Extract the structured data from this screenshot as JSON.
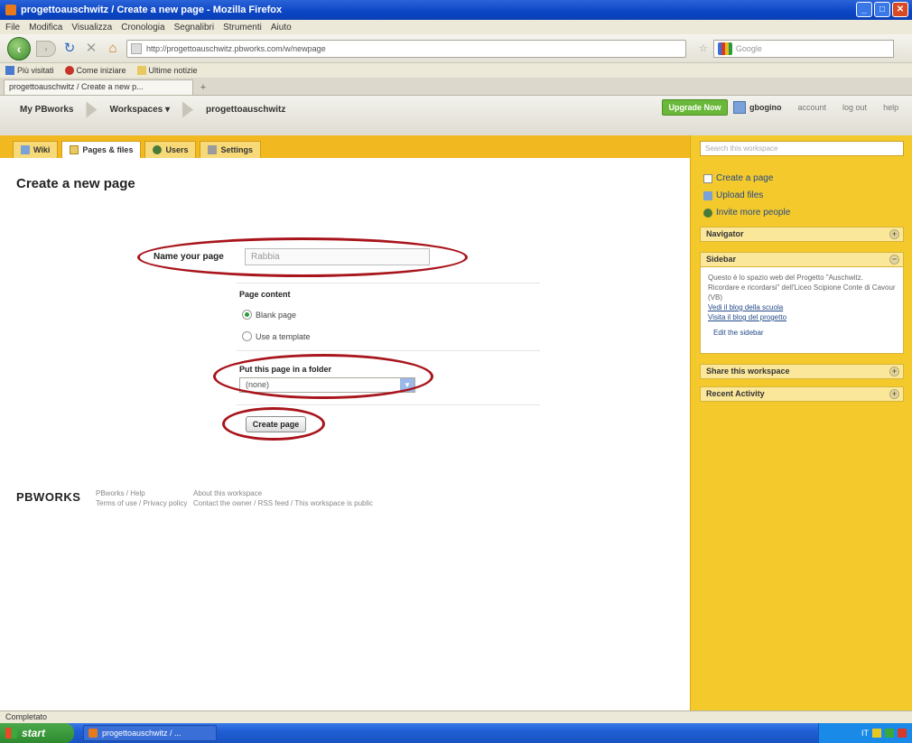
{
  "window": {
    "title": "progettoauschwitz / Create a new page - Mozilla Firefox"
  },
  "menu": [
    "File",
    "Modifica",
    "Visualizza",
    "Cronologia",
    "Segnalibri",
    "Strumenti",
    "Aiuto"
  ],
  "nav": {
    "url": "http://progettoauschwitz.pbworks.com/w/newpage",
    "search_placeholder": "Google"
  },
  "bookmarks": [
    {
      "label": "Più visitati",
      "icon": "blue"
    },
    {
      "label": "Come iniziare",
      "icon": "red"
    },
    {
      "label": "Ultime notizie",
      "icon": "folder"
    }
  ],
  "tab": {
    "label": "progettoauschwitz / Create a new p..."
  },
  "header": {
    "crumbs": [
      "My PBworks",
      "Workspaces",
      "progettoauschwitz"
    ],
    "workspaces_arrow": "▾",
    "upgrade_label": "Upgrade Now",
    "user_name": "gbogino",
    "links": [
      "account",
      "log out",
      "help"
    ]
  },
  "page_tabs": [
    {
      "label": "Wiki",
      "icon": "wiki",
      "active": false
    },
    {
      "label": "Pages & files",
      "icon": "pages",
      "active": true
    },
    {
      "label": "Users",
      "icon": "users",
      "active": false
    },
    {
      "label": "Settings",
      "icon": "settings",
      "active": false
    }
  ],
  "main": {
    "title": "Create a new page",
    "name_label": "Name your page",
    "name_value": "Rabbia",
    "content_label": "Page content",
    "radio_blank": "Blank page",
    "radio_template": "Use a template",
    "folder_label": "Put this page in a folder",
    "folder_value": "(none)",
    "create_button": "Create page"
  },
  "footer": {
    "logo": "PBWORKS",
    "col1": [
      "PBworks / Help",
      "Terms of use / Privacy policy"
    ],
    "col2": [
      "About this workspace",
      "Contact the owner / RSS feed / This workspace is public"
    ]
  },
  "sidebar": {
    "search_placeholder": "Search this workspace",
    "links": [
      {
        "label": "Create a page",
        "icon": "page"
      },
      {
        "label": "Upload files",
        "icon": "upload"
      },
      {
        "label": "Invite more people",
        "icon": "invite"
      }
    ],
    "panels": [
      "Navigator",
      "Sidebar",
      "Share this workspace",
      "Recent Activity"
    ],
    "sidebar_text": "Questo è lo spazio web del Progetto \"Auschwitz. Ricordare e ricordarsi\" dell'Liceo Scipione Conte di Cavour (VB)",
    "sidebar_links": [
      "Vedi il blog della scuola",
      "Visita il blog del progetto"
    ],
    "edit_link": "Edit the sidebar"
  },
  "status": {
    "text": "Completato"
  },
  "taskbar": {
    "start": "start",
    "task": "progettoauschwitz / ...",
    "clock": "IT"
  }
}
